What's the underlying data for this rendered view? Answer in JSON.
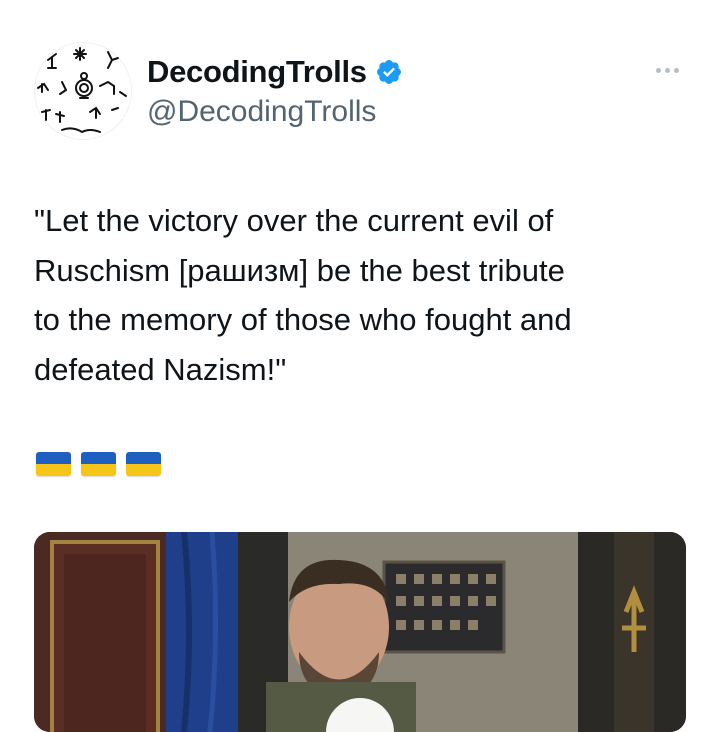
{
  "tweet": {
    "author": {
      "display_name": "DecodingTrolls",
      "handle": "@DecodingTrolls",
      "verified": true,
      "verified_color": "#1d9bf0"
    },
    "more_icon": "ellipsis-icon",
    "text": "\"Let the victory over the current evil of\nRuschism [рашизм] be the best tribute\nto the memory of those who fought and\ndefeated Nazism!\"",
    "flag_colors": {
      "blue": "#1f5fbf",
      "yellow": "#f5c518"
    },
    "flag_count": 3,
    "media": {
      "type": "video"
    }
  }
}
